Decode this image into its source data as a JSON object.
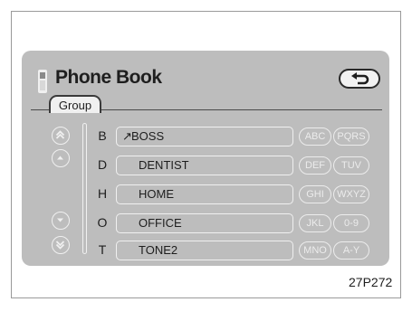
{
  "header": {
    "title": "Phone Book"
  },
  "tabs": {
    "group": "Group"
  },
  "entries": [
    {
      "letter": "B",
      "name": "BOSS",
      "marked": true
    },
    {
      "letter": "D",
      "name": "DENTIST",
      "marked": false
    },
    {
      "letter": "H",
      "name": "HOME",
      "marked": false
    },
    {
      "letter": "O",
      "name": "OFFICE",
      "marked": false
    },
    {
      "letter": "T",
      "name": "TONE2",
      "marked": false
    }
  ],
  "letter_groups": [
    [
      "ABC",
      "PQRS"
    ],
    [
      "DEF",
      "TUV"
    ],
    [
      "GHI",
      "WXYZ"
    ],
    [
      "JKL",
      "0-9"
    ],
    [
      "MNO",
      "A-Y"
    ]
  ],
  "icons": {
    "back": "return-arrow-icon",
    "phone": "phone-icon",
    "page_up": "double-chevron-up-icon",
    "line_up": "chevron-up-icon",
    "line_down": "chevron-down-icon",
    "page_down": "double-chevron-down-icon",
    "mark": "pencil-icon"
  },
  "marks": {
    "selected": "↗"
  },
  "caption": "27P272",
  "colors": {
    "screen_bg": "#bdbdbd",
    "outline": "#f0f0f0",
    "text": "#1e1e1e"
  }
}
